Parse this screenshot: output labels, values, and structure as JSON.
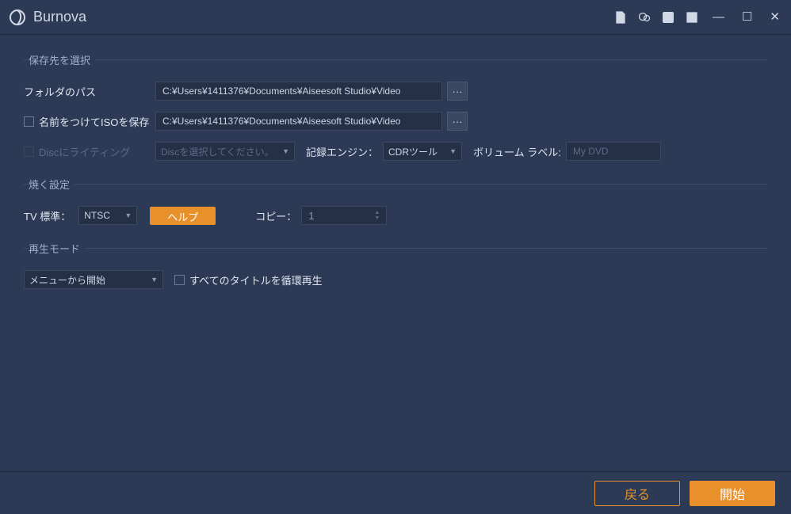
{
  "app": {
    "title": "Burnova"
  },
  "sections": {
    "saveDest": {
      "title": "保存先を選択",
      "folderPath": {
        "label": "フォルダのパス",
        "value": "C:¥Users¥1411376¥Documents¥Aiseesoft Studio¥Video"
      },
      "saveIso": {
        "label": "名前をつけてISOを保存",
        "value": "C:¥Users¥1411376¥Documents¥Aiseesoft Studio¥Video"
      },
      "discWrite": {
        "label": "Discにライティング",
        "selectPlaceholder": "Discを選択してください。"
      },
      "recEngine": {
        "label": "記録エンジン：",
        "value": "CDRツール"
      },
      "volumeLabel": {
        "label": "ボリューム ラベル:",
        "placeholder": "My DVD"
      }
    },
    "burn": {
      "title": "焼く設定",
      "tvStandard": {
        "label": "TV 標準：",
        "value": "NTSC"
      },
      "helpBtn": "ヘルプ",
      "copy": {
        "label": "コピー：",
        "value": "1"
      }
    },
    "playMode": {
      "title": "再生モード",
      "startFrom": {
        "value": "メニューから開始"
      },
      "loopAll": {
        "label": "すべてのタイトルを循環再生"
      }
    }
  },
  "footer": {
    "back": "戻る",
    "start": "開始"
  }
}
